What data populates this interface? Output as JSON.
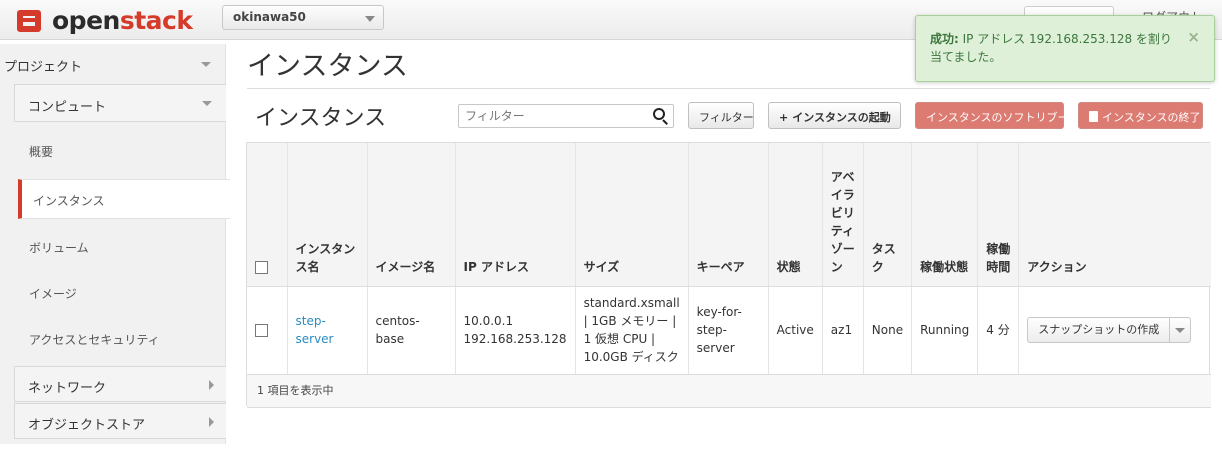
{
  "header": {
    "logo_open": "open",
    "logo_stack": "stack",
    "project_selector": "okinawa50",
    "logout": "ログアウト"
  },
  "sidebar": {
    "project_label": "プロジェクト",
    "compute_label": "コンピュート",
    "items": [
      "概要",
      "インスタンス",
      "ボリューム",
      "イメージ",
      "アクセスとセキュリティ"
    ],
    "active_item": "インスタンス",
    "network_label": "ネットワーク",
    "object_store_label": "オブジェクトストア"
  },
  "main": {
    "page_title": "インスタンス",
    "section_title": "インスタンス",
    "filter_placeholder": "フィルター",
    "filter_button": "フィルター",
    "launch_button": "インスタンスの起動",
    "soft_reboot_button": "インスタンスのソフトリブート",
    "terminate_button": "インスタンスの終了"
  },
  "table": {
    "headers": {
      "name": "インスタンス名",
      "image": "イメージ名",
      "ip": "IP アドレス",
      "size": "サイズ",
      "keypair": "キーペア",
      "status": "状態",
      "az": "アベイラビリティゾーン",
      "task": "タスク",
      "power": "稼働状態",
      "uptime": "稼働時間",
      "actions": "アクション"
    },
    "rows": [
      {
        "name": "step-server",
        "image": "centos-base",
        "ip_1": "10.0.0.1",
        "ip_2": "192.168.253.128",
        "size": "standard.xsmall | 1GB メモリー | 1 仮想 CPU | 10.0GB ディスク",
        "keypair": "key-for-step-server",
        "status": "Active",
        "az": "az1",
        "task": "None",
        "power": "Running",
        "uptime": "4 分",
        "action": "スナップショットの作成"
      }
    ],
    "footer": "1 項目を表示中"
  },
  "alert": {
    "title": "成功:",
    "message": "IP アドレス 192.168.253.128 を割り当てました。",
    "close": "×"
  },
  "colors": {
    "brand_red": "#d53b2a",
    "link_blue": "#2a8bc1",
    "danger_button": "#dc7b72",
    "success_bg": "#dff0d8"
  }
}
